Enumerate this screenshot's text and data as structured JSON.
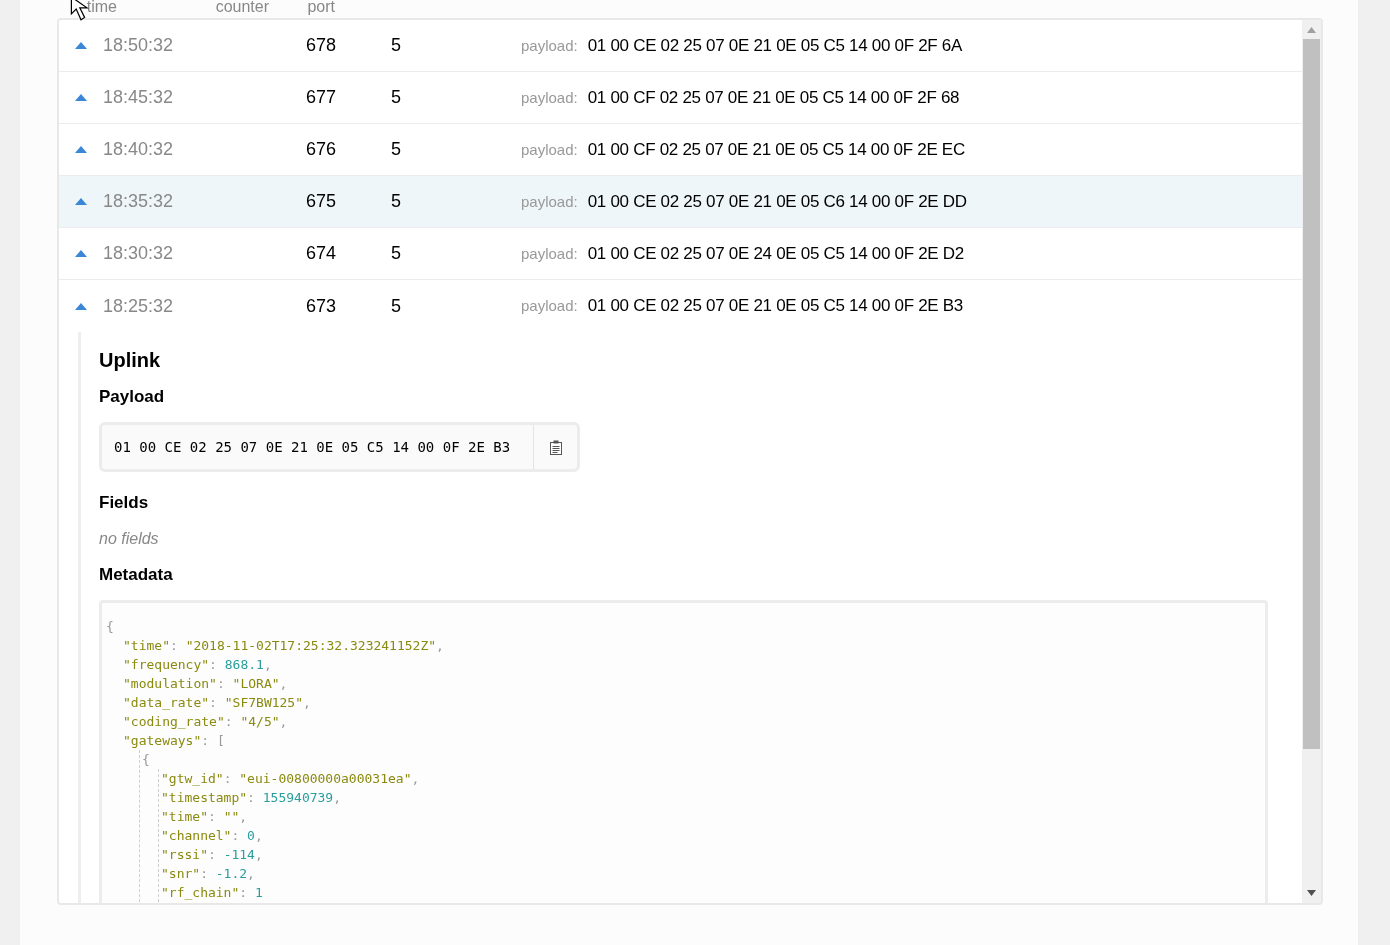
{
  "columns": [
    "time",
    "counter",
    "port"
  ],
  "rows": [
    {
      "time": "18:50:32",
      "counter": "678",
      "port": "5",
      "payload_label": "payload:",
      "payload": "01 00 CE 02 25 07 0E 21 0E 05 C5 14 00 0F 2F 6A",
      "highlighted": false,
      "expanded": false
    },
    {
      "time": "18:45:32",
      "counter": "677",
      "port": "5",
      "payload_label": "payload:",
      "payload": "01 00 CF 02 25 07 0E 21 0E 05 C5 14 00 0F 2F 68",
      "highlighted": false,
      "expanded": false
    },
    {
      "time": "18:40:32",
      "counter": "676",
      "port": "5",
      "payload_label": "payload:",
      "payload": "01 00 CF 02 25 07 0E 21 0E 05 C5 14 00 0F 2E EC",
      "highlighted": false,
      "expanded": false
    },
    {
      "time": "18:35:32",
      "counter": "675",
      "port": "5",
      "payload_label": "payload:",
      "payload": "01 00 CE 02 25 07 0E 21 0E 05 C6 14 00 0F 2E DD",
      "highlighted": true,
      "expanded": false
    },
    {
      "time": "18:30:32",
      "counter": "674",
      "port": "5",
      "payload_label": "payload:",
      "payload": "01 00 CE 02 25 07 0E 24 0E 05 C5 14 00 0F 2E D2",
      "highlighted": false,
      "expanded": false
    },
    {
      "time": "18:25:32",
      "counter": "673",
      "port": "5",
      "payload_label": "payload:",
      "payload": "01 00 CE 02 25 07 0E 21 0E 05 C5 14 00 0F 2E B3",
      "highlighted": false,
      "expanded": true
    }
  ],
  "details": {
    "title": "Uplink",
    "payload_heading": "Payload",
    "payload": "01 00 CE 02 25 07 0E 21 0E 05 C5 14 00 0F 2E B3",
    "fields_heading": "Fields",
    "fields_empty": "no fields",
    "metadata_heading": "Metadata",
    "metadata": [
      {
        "segments": [
          {
            "kind": "punct",
            "text": "{"
          }
        ],
        "children": [
          {
            "segments": [
              {
                "kind": "key",
                "text": "\"time\""
              },
              {
                "kind": "punct",
                "text": ": "
              },
              {
                "kind": "string",
                "text": "\"2018-11-02T17:25:32.323241152Z\""
              },
              {
                "kind": "punct",
                "text": ","
              }
            ]
          },
          {
            "segments": [
              {
                "kind": "key",
                "text": "\"frequency\""
              },
              {
                "kind": "punct",
                "text": ": "
              },
              {
                "kind": "number",
                "text": "868.1"
              },
              {
                "kind": "punct",
                "text": ","
              }
            ]
          },
          {
            "segments": [
              {
                "kind": "key",
                "text": "\"modulation\""
              },
              {
                "kind": "punct",
                "text": ": "
              },
              {
                "kind": "string",
                "text": "\"LORA\""
              },
              {
                "kind": "punct",
                "text": ","
              }
            ]
          },
          {
            "segments": [
              {
                "kind": "key",
                "text": "\"data_rate\""
              },
              {
                "kind": "punct",
                "text": ": "
              },
              {
                "kind": "string",
                "text": "\"SF7BW125\""
              },
              {
                "kind": "punct",
                "text": ","
              }
            ]
          },
          {
            "segments": [
              {
                "kind": "key",
                "text": "\"coding_rate\""
              },
              {
                "kind": "punct",
                "text": ": "
              },
              {
                "kind": "string",
                "text": "\"4/5\""
              },
              {
                "kind": "punct",
                "text": ","
              }
            ]
          },
          {
            "segments": [
              {
                "kind": "key",
                "text": "\"gateways\""
              },
              {
                "kind": "punct",
                "text": ": ["
              }
            ],
            "children": [
              {
                "segments": [
                  {
                    "kind": "punct",
                    "text": "{"
                  }
                ],
                "children": [
                  {
                    "segments": [
                      {
                        "kind": "key",
                        "text": "\"gtw_id\""
                      },
                      {
                        "kind": "punct",
                        "text": ": "
                      },
                      {
                        "kind": "string",
                        "text": "\"eui-00800000a00031ea\""
                      },
                      {
                        "kind": "punct",
                        "text": ","
                      }
                    ]
                  },
                  {
                    "segments": [
                      {
                        "kind": "key",
                        "text": "\"timestamp\""
                      },
                      {
                        "kind": "punct",
                        "text": ": "
                      },
                      {
                        "kind": "number",
                        "text": "155940739"
                      },
                      {
                        "kind": "punct",
                        "text": ","
                      }
                    ]
                  },
                  {
                    "segments": [
                      {
                        "kind": "key",
                        "text": "\"time\""
                      },
                      {
                        "kind": "punct",
                        "text": ": "
                      },
                      {
                        "kind": "string",
                        "text": "\"\""
                      },
                      {
                        "kind": "punct",
                        "text": ","
                      }
                    ]
                  },
                  {
                    "segments": [
                      {
                        "kind": "key",
                        "text": "\"channel\""
                      },
                      {
                        "kind": "punct",
                        "text": ": "
                      },
                      {
                        "kind": "number",
                        "text": "0"
                      },
                      {
                        "kind": "punct",
                        "text": ","
                      }
                    ]
                  },
                  {
                    "segments": [
                      {
                        "kind": "key",
                        "text": "\"rssi\""
                      },
                      {
                        "kind": "punct",
                        "text": ": "
                      },
                      {
                        "kind": "number",
                        "text": "-114"
                      },
                      {
                        "kind": "punct",
                        "text": ","
                      }
                    ]
                  },
                  {
                    "segments": [
                      {
                        "kind": "key",
                        "text": "\"snr\""
                      },
                      {
                        "kind": "punct",
                        "text": ": "
                      },
                      {
                        "kind": "number",
                        "text": "-1.2"
                      },
                      {
                        "kind": "punct",
                        "text": ","
                      }
                    ]
                  },
                  {
                    "segments": [
                      {
                        "kind": "key",
                        "text": "\"rf_chain\""
                      },
                      {
                        "kind": "punct",
                        "text": ": "
                      },
                      {
                        "kind": "number",
                        "text": "1"
                      }
                    ]
                  }
                ]
              }
            ]
          }
        ]
      }
    ]
  }
}
